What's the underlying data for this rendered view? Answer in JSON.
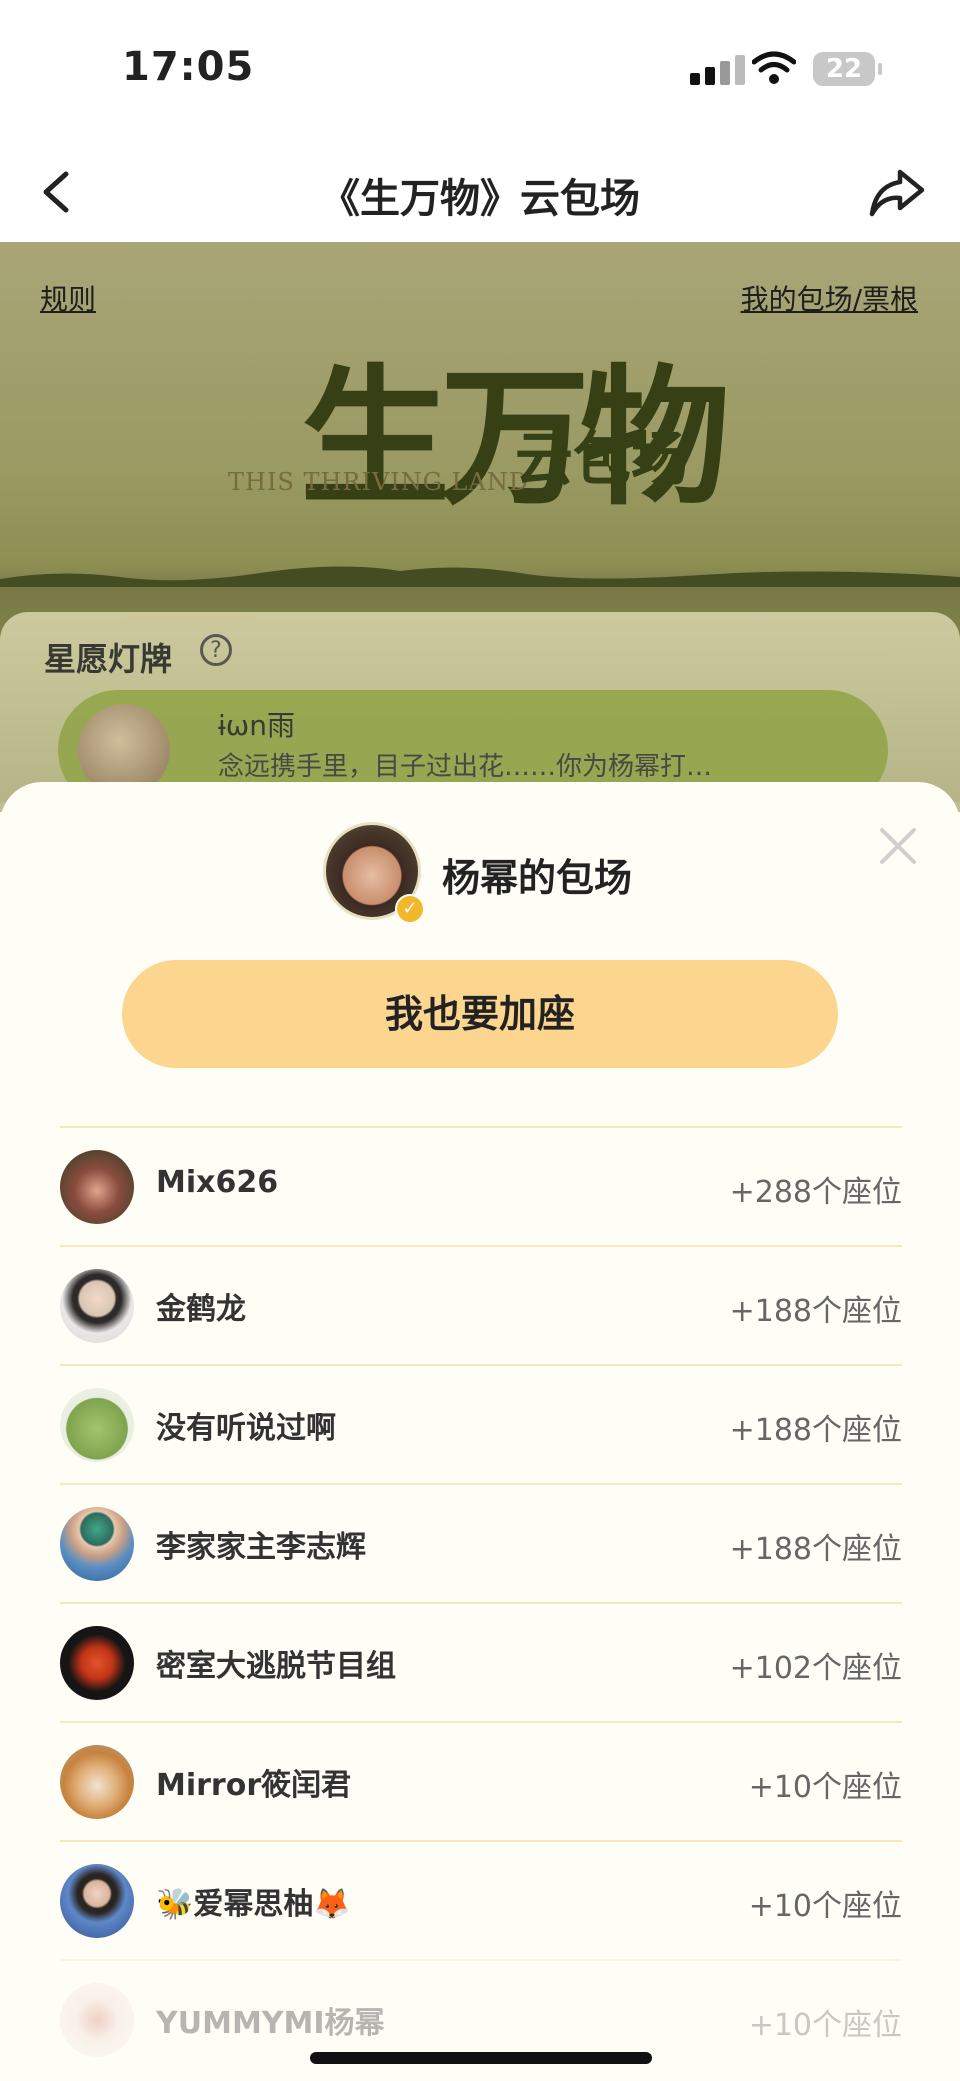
{
  "status_bar": {
    "time": "17:05",
    "battery": "22"
  },
  "nav": {
    "title": "《生万物》云包场"
  },
  "hero": {
    "rules_link": "规则",
    "my_link": "我的包场/票根",
    "logo_cn": "生万物",
    "logo_en": "THIS THRIVING LAND",
    "logo_sub": "云包场"
  },
  "star_wish": {
    "title": "星愿灯牌",
    "help_icon": "?",
    "card_name": "ɨωn雨",
    "card_text": "念远携手里，目子过出花……你为杨幂打…",
    "avatar_icon": "user-avatar"
  },
  "sheet": {
    "owner_title": "杨幂的包场",
    "verified_icon": "✓",
    "join_button": "我也要加座",
    "rows": [
      {
        "name": "Mix626",
        "seats": "+288个座位",
        "color": "#5a3b33"
      },
      {
        "name": "金鹤龙",
        "seats": "+188个座位",
        "color": "#d9d6d2"
      },
      {
        "name": "没有听说过啊",
        "seats": "+188个座位",
        "color": "#7fa34e"
      },
      {
        "name": "李家家主李志辉",
        "seats": "+188个座位",
        "color": "#4d7fa8"
      },
      {
        "name": "密室大逃脱节目组",
        "seats": "+102个座位",
        "color": "#151515"
      },
      {
        "name": "Mirror筱闰君",
        "seats": "+10个座位",
        "color": "#d9a066"
      },
      {
        "name": "🐝爱幂思柚🦊",
        "seats": "+10个座位",
        "color": "#3c67a8"
      },
      {
        "name": "YUMMYMI杨幂",
        "seats": "+10个座位",
        "color": "#e9d9c8"
      }
    ]
  }
}
